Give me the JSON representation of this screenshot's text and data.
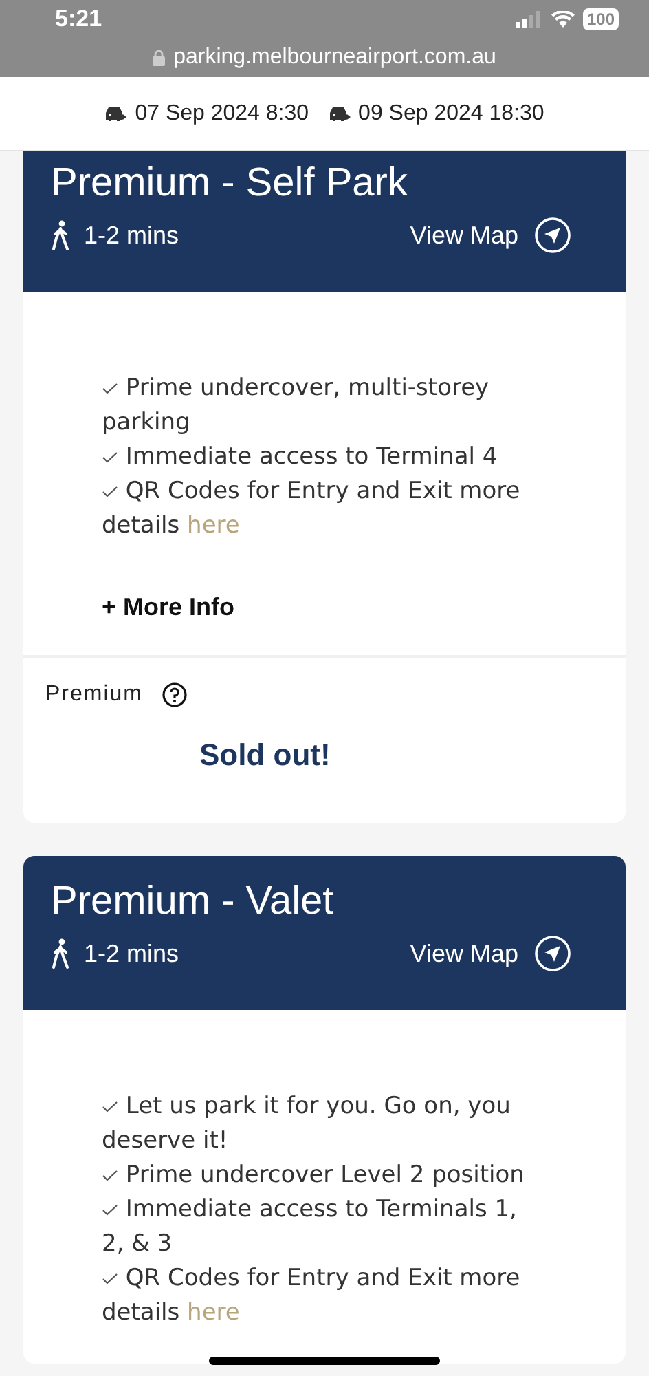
{
  "status_bar": {
    "time": "5:21",
    "battery": "100"
  },
  "address_bar": {
    "url": "parking.melbourneairport.com.au"
  },
  "booking": {
    "dates": [
      {
        "text": "07 Sep 2024 8:30"
      },
      {
        "text": "09 Sep 2024 18:30"
      }
    ]
  },
  "cards": [
    {
      "title": "Premium - Self Park",
      "walk_time": "1-2 mins",
      "map_link": "View Map",
      "features": [
        {
          "text": "Prime undercover, multi-storey parking"
        },
        {
          "text": "Immediate access to Terminal 4"
        },
        {
          "text": "QR Codes for Entry and Exit more details",
          "link": "here"
        }
      ],
      "more_info": "+ More Info",
      "product": "Premium",
      "availability": "Sold out!"
    },
    {
      "title": "Premium - Valet",
      "walk_time": "1-2 mins",
      "map_link": "View Map",
      "features": [
        {
          "text": "Let us park it for you. Go on, you deserve it!"
        },
        {
          "text": "Prime undercover Level 2 position"
        },
        {
          "text": "Immediate access to Terminals 1, 2, & 3"
        },
        {
          "text": "QR Codes for Entry and Exit more details",
          "link": "here"
        }
      ]
    }
  ]
}
